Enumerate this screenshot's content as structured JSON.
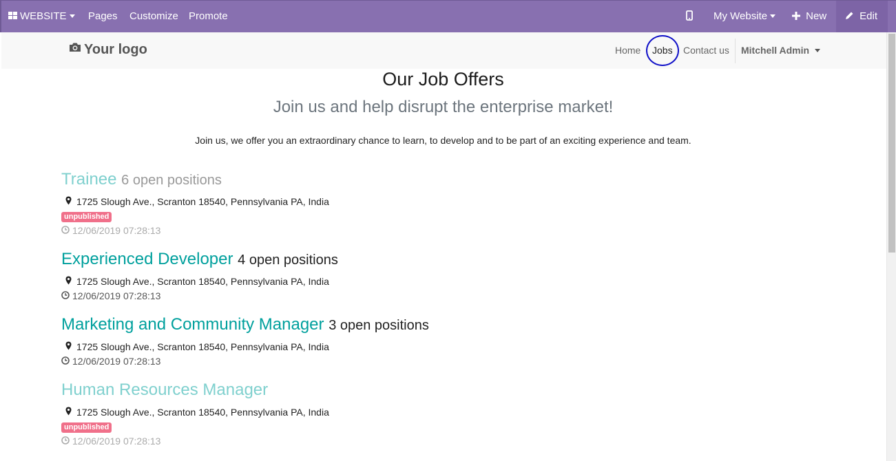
{
  "admin_bar": {
    "website_menu": "WEBSITE",
    "pages": "Pages",
    "customize": "Customize",
    "promote": "Promote",
    "my_website": "My Website",
    "new": "New",
    "edit": "Edit",
    "color": "#8870b0"
  },
  "header": {
    "logo_text": "Your logo",
    "nav": {
      "home": "Home",
      "jobs": "Jobs",
      "contact": "Contact us"
    },
    "user": "Mitchell Admin"
  },
  "main": {
    "title": "Our Job Offers",
    "subtitle": "Join us and help disrupt the enterprise market!",
    "description": "Join us, we offer you an extraordinary chance to learn, to develop and to be part of an exciting experience and team."
  },
  "jobs": [
    {
      "name": "Trainee",
      "positions": "6 open positions",
      "address": "1725 Slough Ave., Scranton 18540, Pennsylvania PA, India",
      "badge": "unpublished",
      "date": "12/06/2019 07:28:13"
    },
    {
      "name": "Experienced Developer",
      "positions": "4 open positions",
      "address": "1725 Slough Ave., Scranton 18540, Pennsylvania PA, India",
      "date": "12/06/2019 07:28:13"
    },
    {
      "name": "Marketing and Community Manager",
      "positions": "3 open positions",
      "address": "1725 Slough Ave., Scranton 18540, Pennsylvania PA, India",
      "date": "12/06/2019 07:28:13"
    },
    {
      "name": "Human Resources Manager",
      "positions": "",
      "address": "1725 Slough Ave., Scranton 18540, Pennsylvania PA, India",
      "badge": "unpublished",
      "date": "12/06/2019 07:28:13"
    }
  ],
  "colors": {
    "link": "#00a09d",
    "unpublished_badge": "#f0708a",
    "highlight_circle": "#1010c8"
  }
}
